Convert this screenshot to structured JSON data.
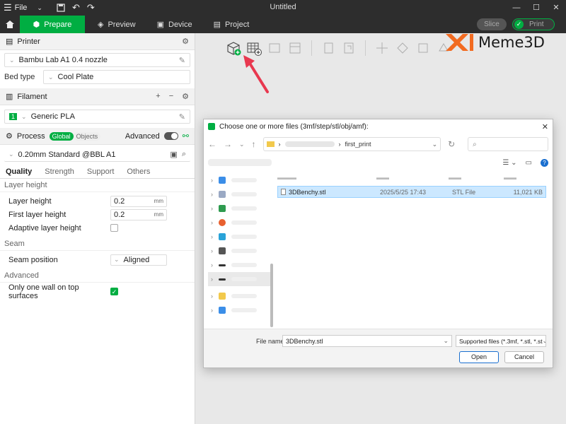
{
  "titlebar": {
    "menu_label": "File",
    "title": "Untitled"
  },
  "tabs": [
    {
      "label": "Prepare"
    },
    {
      "label": "Preview"
    },
    {
      "label": "Device"
    },
    {
      "label": "Project"
    }
  ],
  "actions": {
    "slice": "Slice",
    "print": "Print"
  },
  "printer": {
    "header": "Printer",
    "name": "Bambu Lab A1 0.4 nozzle",
    "bed_type_label": "Bed type",
    "bed_type": "Cool Plate"
  },
  "filament": {
    "header": "Filament",
    "index": "1",
    "name": "Generic PLA"
  },
  "process": {
    "header": "Process",
    "global_label": "Global",
    "objects_label": "Objects",
    "advanced_label": "Advanced",
    "preset": "0.20mm Standard @BBL A1",
    "tabs": [
      "Quality",
      "Strength",
      "Support",
      "Others"
    ],
    "layer_height_group": "Layer height",
    "layer_height_label": "Layer height",
    "layer_height": "0.2",
    "first_layer_label": "First layer height",
    "first_layer": "0.2",
    "unit": "mm",
    "adaptive_label": "Adaptive layer height",
    "seam_group": "Seam",
    "seam_pos_label": "Seam position",
    "seam_pos": "Aligned",
    "advanced_group": "Advanced",
    "one_wall_label": "Only one wall on top surfaces"
  },
  "logo": {
    "brand": "Meme3D"
  },
  "dialog": {
    "title": "Choose one or more files (3mf/step/stl/obj/amf):",
    "path_folder": "first_print",
    "file": {
      "name": "3DBenchy.stl",
      "date": "2025/5/25 17:43",
      "type": "STL File",
      "size": "11,021 KB"
    },
    "file_name_label": "File name:",
    "file_name_value": "3DBenchy.stl",
    "file_type": "Supported files (*.3mf, *.stl, *.st",
    "open": "Open",
    "cancel": "Cancel"
  },
  "colors": {
    "accent": "#00ae42",
    "titlebar": "#2d2d2d",
    "arrow": "#e8384f",
    "logo_orange": "#f26b21"
  }
}
